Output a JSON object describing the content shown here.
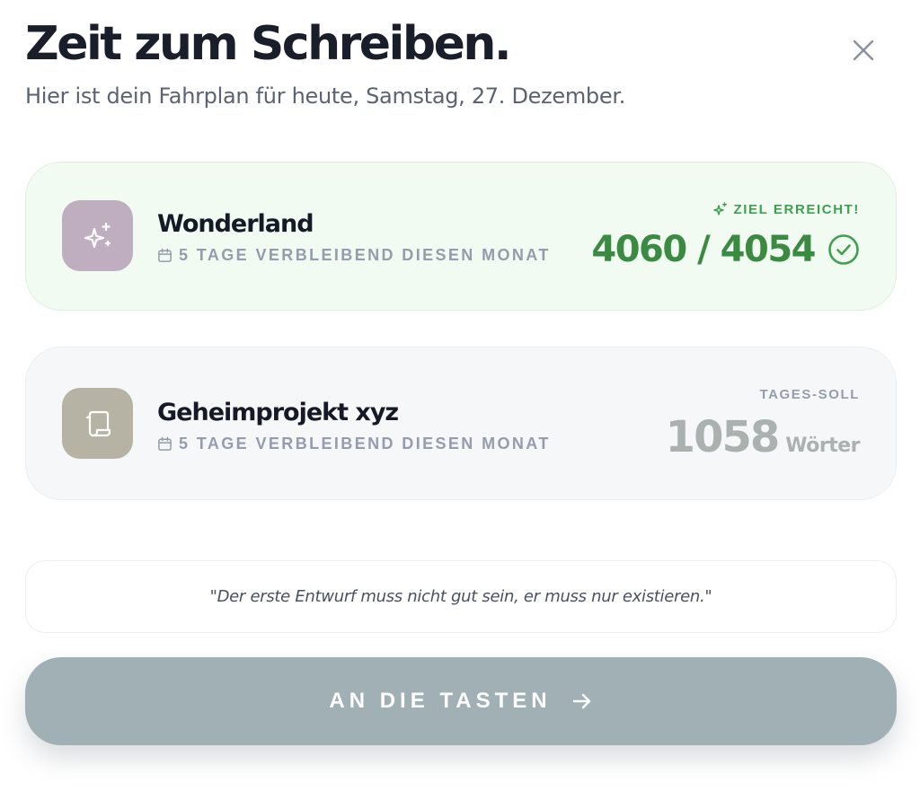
{
  "header": {
    "title": "Zeit zum Schreiben.",
    "subtitle": "Hier ist dein Fahrplan für heute, Samstag, 27. Dezember."
  },
  "close": {
    "icon": "close-icon"
  },
  "projects": [
    {
      "name": "Wonderland",
      "icon": "sparkles-icon",
      "icon_color": "#bfaebf",
      "days_remaining": "5 TAGE VERBLEIBEND DIESEN MONAT",
      "status_label": "ZIEL ERREICHT!",
      "progress": "4060 / 4054",
      "status_color": "#3a8a41"
    },
    {
      "name": "Geheimprojekt xyz",
      "icon": "scroll-icon",
      "icon_color": "#b6b2a4",
      "days_remaining": "5 TAGE VERBLEIBEND DIESEN MONAT",
      "daily_label": "TAGES-SOLL",
      "daily_value": "1058",
      "daily_unit": "Wörter"
    }
  ],
  "quote": "\"Der erste Entwurf muss nicht gut sein, er muss nur existieren.\"",
  "cta": {
    "label": "AN DIE TASTEN",
    "icon": "arrow-right-icon"
  }
}
